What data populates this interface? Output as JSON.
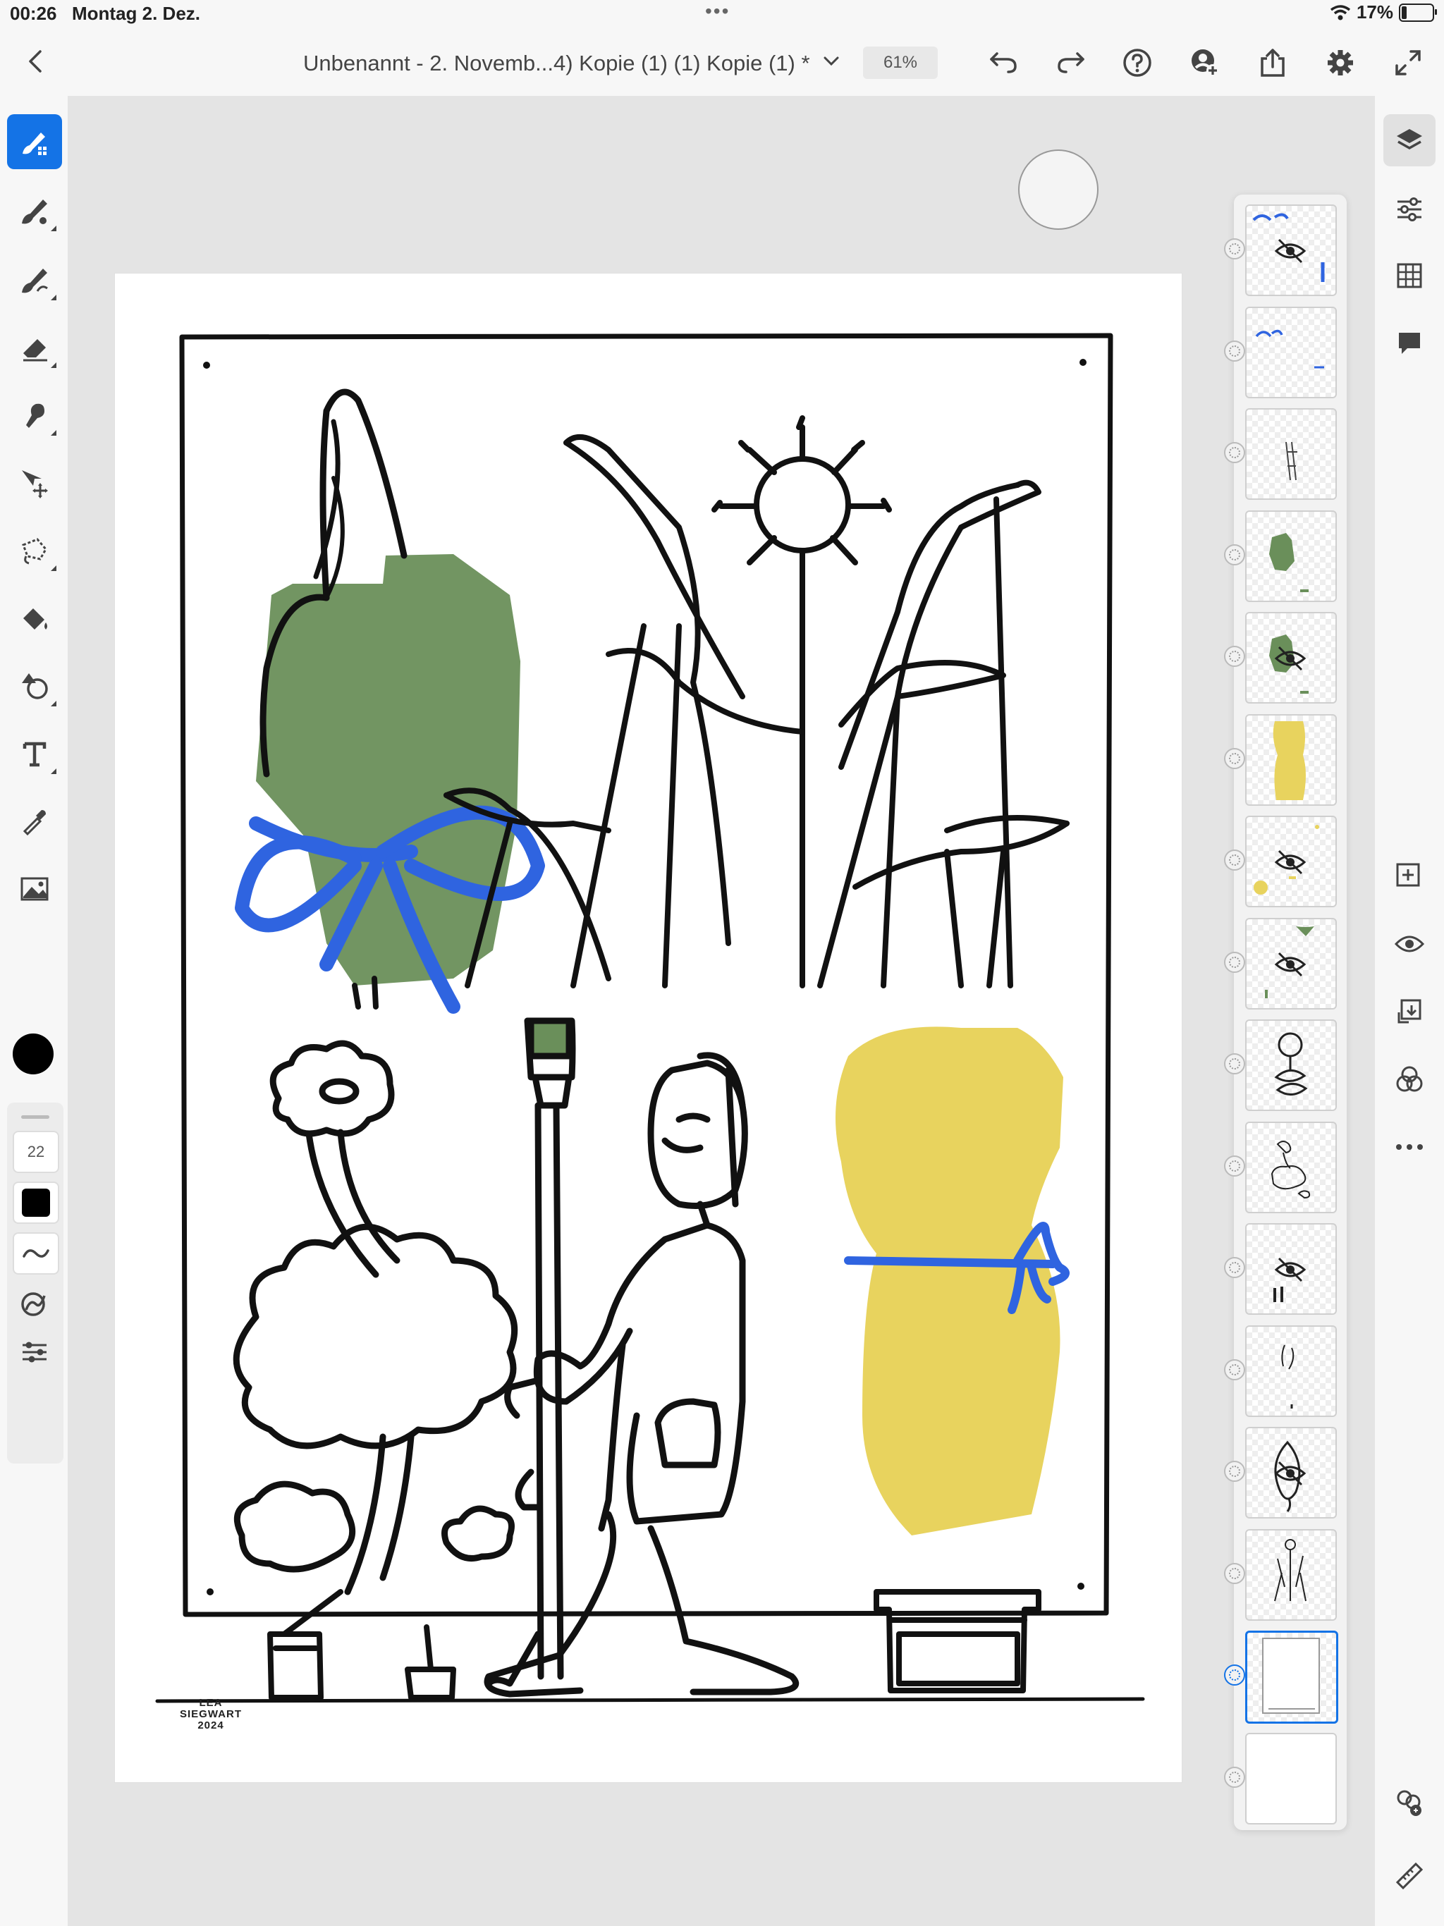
{
  "status_bar": {
    "time": "00:26",
    "date": "Montag 2. Dez.",
    "battery_percent": "17%",
    "center_dots": "•••"
  },
  "document": {
    "title": "Unbenannt - 2. Novemb...4) Kopie (1) (1) Kopie (1) *",
    "zoom": "61%"
  },
  "toolbar_top": {
    "icons": [
      "back-icon",
      "chevron-down-icon",
      "undo-icon",
      "redo-icon",
      "help-icon",
      "add-user-icon",
      "share-icon",
      "settings-icon",
      "fullscreen-icon"
    ]
  },
  "tools_left": {
    "icons": [
      "pixel-brush-icon",
      "live-brush-icon",
      "vector-brush-icon",
      "eraser-icon",
      "smudge-icon",
      "move-icon",
      "lasso-icon",
      "fill-icon",
      "shape-icon",
      "text-icon",
      "eyedropper-icon",
      "image-icon"
    ],
    "active_tool": "pixel-brush-icon",
    "current_color": "#000000",
    "brush_size": "22",
    "panel_icons": [
      "smoothing-icon",
      "pressure-icon",
      "brush-settings-icon"
    ]
  },
  "tools_right": {
    "icons": [
      "layers-icon",
      "adjustments-icon",
      "grid-icon",
      "comment-icon",
      "add-layer-icon",
      "visibility-icon",
      "merge-down-icon",
      "blend-icon",
      "more-icon",
      "color-replace-icon",
      "ruler-icon"
    ],
    "active_tool": "layers-icon"
  },
  "artwork": {
    "signature": [
      "LEA",
      "SIEGWART",
      "2024"
    ],
    "colors": {
      "green": "#6a8f5a",
      "yellow": "#e8d35e",
      "blue": "#2f64e0",
      "ink": "#111111"
    }
  },
  "layers": [
    {
      "hidden": true,
      "kind": "blue-ribbon"
    },
    {
      "hidden": false,
      "kind": "blue-ribbon-small"
    },
    {
      "hidden": false,
      "kind": "sketch"
    },
    {
      "hidden": false,
      "kind": "green-shape"
    },
    {
      "hidden": true,
      "kind": "green-shape"
    },
    {
      "hidden": false,
      "kind": "yellow-shape"
    },
    {
      "hidden": true,
      "kind": "yellow-spots"
    },
    {
      "hidden": true,
      "kind": "green-fan"
    },
    {
      "hidden": false,
      "kind": "flower-line"
    },
    {
      "hidden": false,
      "kind": "cloud-line"
    },
    {
      "hidden": true,
      "kind": "legs"
    },
    {
      "hidden": false,
      "kind": "leaf-line"
    },
    {
      "hidden": true,
      "kind": "pod-line"
    },
    {
      "hidden": false,
      "kind": "plant-line"
    },
    {
      "hidden": false,
      "kind": "frame",
      "selected": true
    },
    {
      "hidden": false,
      "kind": "background"
    }
  ]
}
